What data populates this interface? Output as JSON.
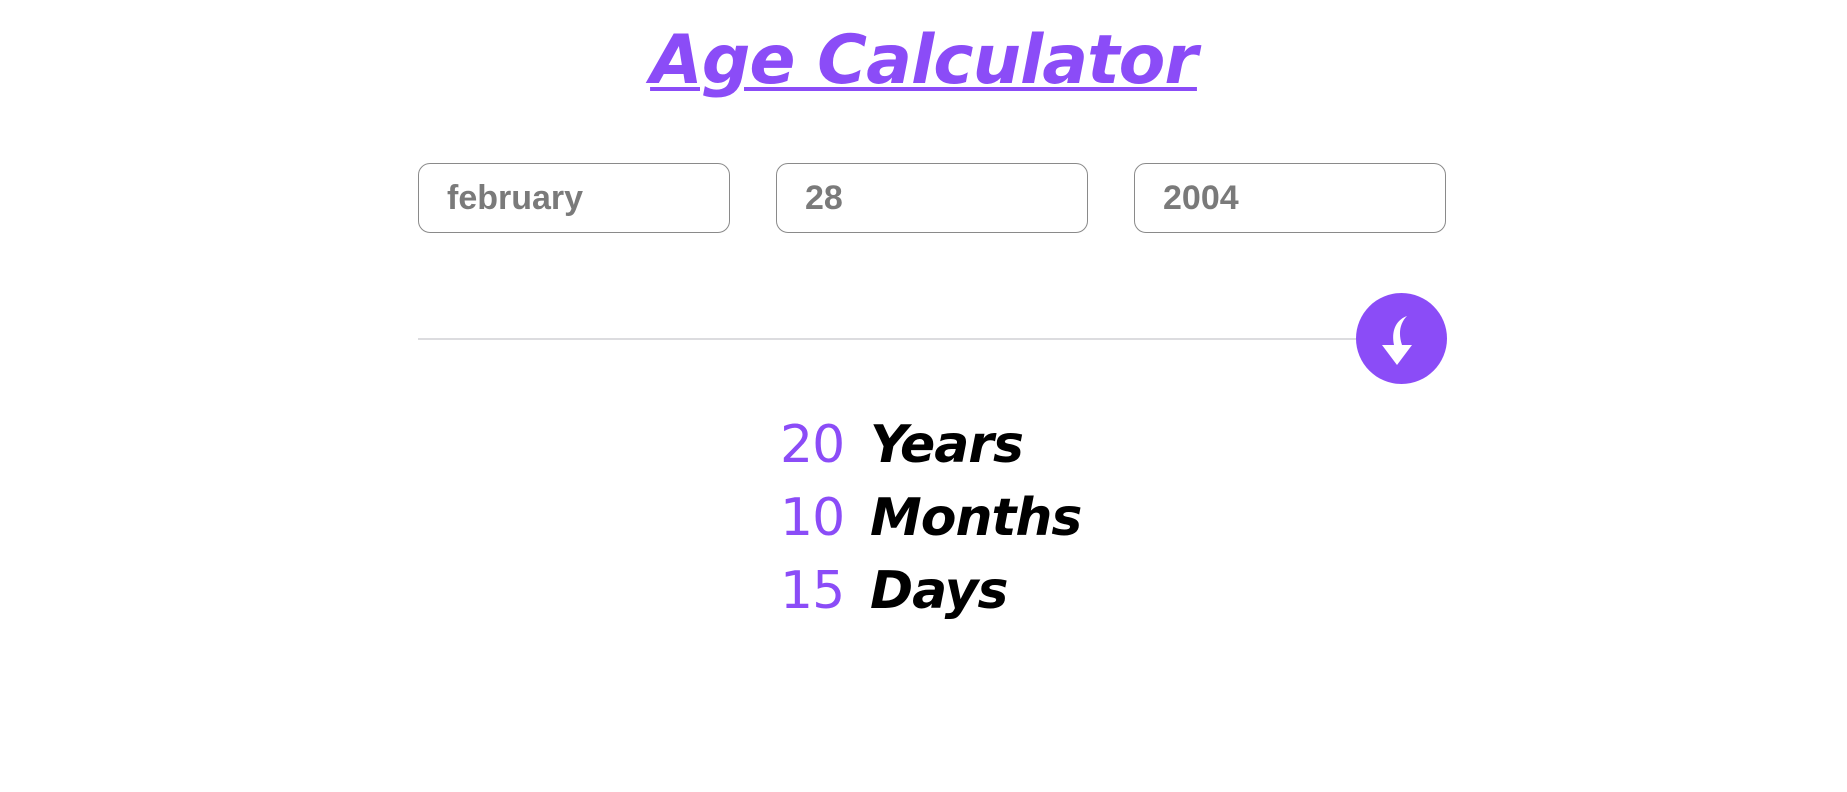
{
  "title": "Age Calculator",
  "inputs": {
    "month": {
      "value": "february"
    },
    "day": {
      "value": "28"
    },
    "year": {
      "value": "2004"
    }
  },
  "calculate_button": {
    "icon": "arrow-down-icon"
  },
  "results": {
    "years": {
      "value": "20",
      "label": "Years"
    },
    "months": {
      "value": "10",
      "label": "Months"
    },
    "days": {
      "value": "15",
      "label": "Days"
    }
  },
  "colors": {
    "accent": "#8b4cf7",
    "divider": "#dcdcdf",
    "input_text": "#7a7a7a",
    "input_border": "#8a8a8a"
  }
}
